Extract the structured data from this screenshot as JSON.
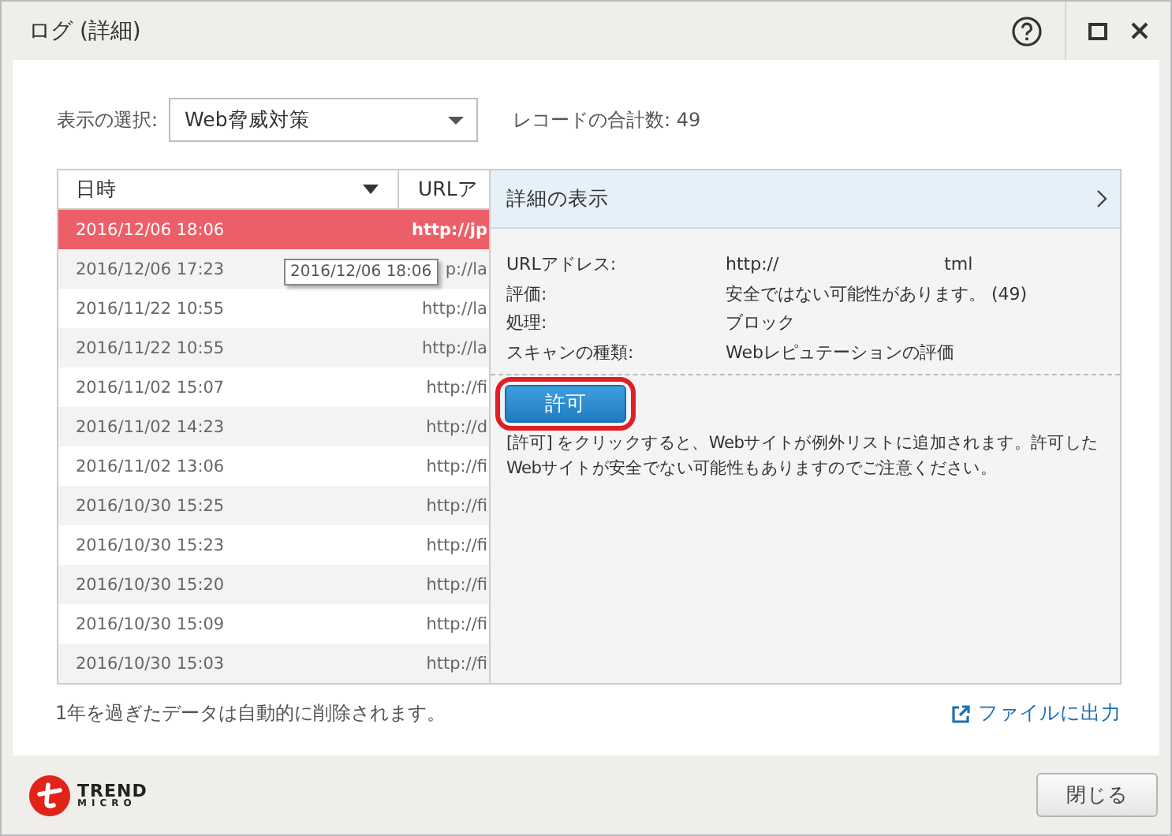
{
  "window": {
    "title": "ログ (詳細)"
  },
  "filter": {
    "label": "表示の選択:",
    "value": "Web脅威対策",
    "record_count": "レコードの合計数: 49"
  },
  "table": {
    "columns": [
      {
        "label": "日時"
      },
      {
        "label": "URLア"
      }
    ],
    "rows": [
      {
        "datetime": "2016/12/06 18:06",
        "url": "http://jp",
        "selected": true
      },
      {
        "datetime": "2016/12/06 17:23",
        "url": "p://la",
        "selected": false
      },
      {
        "datetime": "2016/11/22 10:55",
        "url": "http://la",
        "selected": false
      },
      {
        "datetime": "2016/11/22 10:55",
        "url": "http://la",
        "selected": false
      },
      {
        "datetime": "2016/11/02 15:07",
        "url": "http://fi",
        "selected": false
      },
      {
        "datetime": "2016/11/02 14:23",
        "url": "http://d",
        "selected": false
      },
      {
        "datetime": "2016/11/02 13:06",
        "url": "http://fi",
        "selected": false
      },
      {
        "datetime": "2016/10/30 15:25",
        "url": "http://fi",
        "selected": false
      },
      {
        "datetime": "2016/10/30 15:23",
        "url": "http://fi",
        "selected": false
      },
      {
        "datetime": "2016/10/30 15:20",
        "url": "http://fi",
        "selected": false
      },
      {
        "datetime": "2016/10/30 15:09",
        "url": "http://fi",
        "selected": false
      },
      {
        "datetime": "2016/10/30 15:03",
        "url": "http://fi",
        "selected": false
      }
    ],
    "tooltip": "2016/12/06 18:06"
  },
  "details": {
    "title": "詳細の表示",
    "fields": [
      {
        "label": "URLアドレス:",
        "value": "http://                              tml"
      },
      {
        "label": "評価:",
        "value": "安全ではない可能性があります。 (49)"
      },
      {
        "label": "処理:",
        "value": "ブロック"
      },
      {
        "label": "スキャンの種類:",
        "value": "Webレピュテーションの評価"
      }
    ],
    "allow_button": "許可",
    "note": "[許可] をクリックすると、Webサイトが例外リストに追加されます。許可したWebサイトが安全でない可能性もありますのでご注意ください。",
    "annotation": {
      "kind": "ring"
    }
  },
  "footer_note": "1年を過ぎたデータは自動的に削除されます。",
  "export_link": "ファイルに出力",
  "logo": {
    "line1": "TREND",
    "line2": "MICRO"
  },
  "close_button": "閉じる"
}
